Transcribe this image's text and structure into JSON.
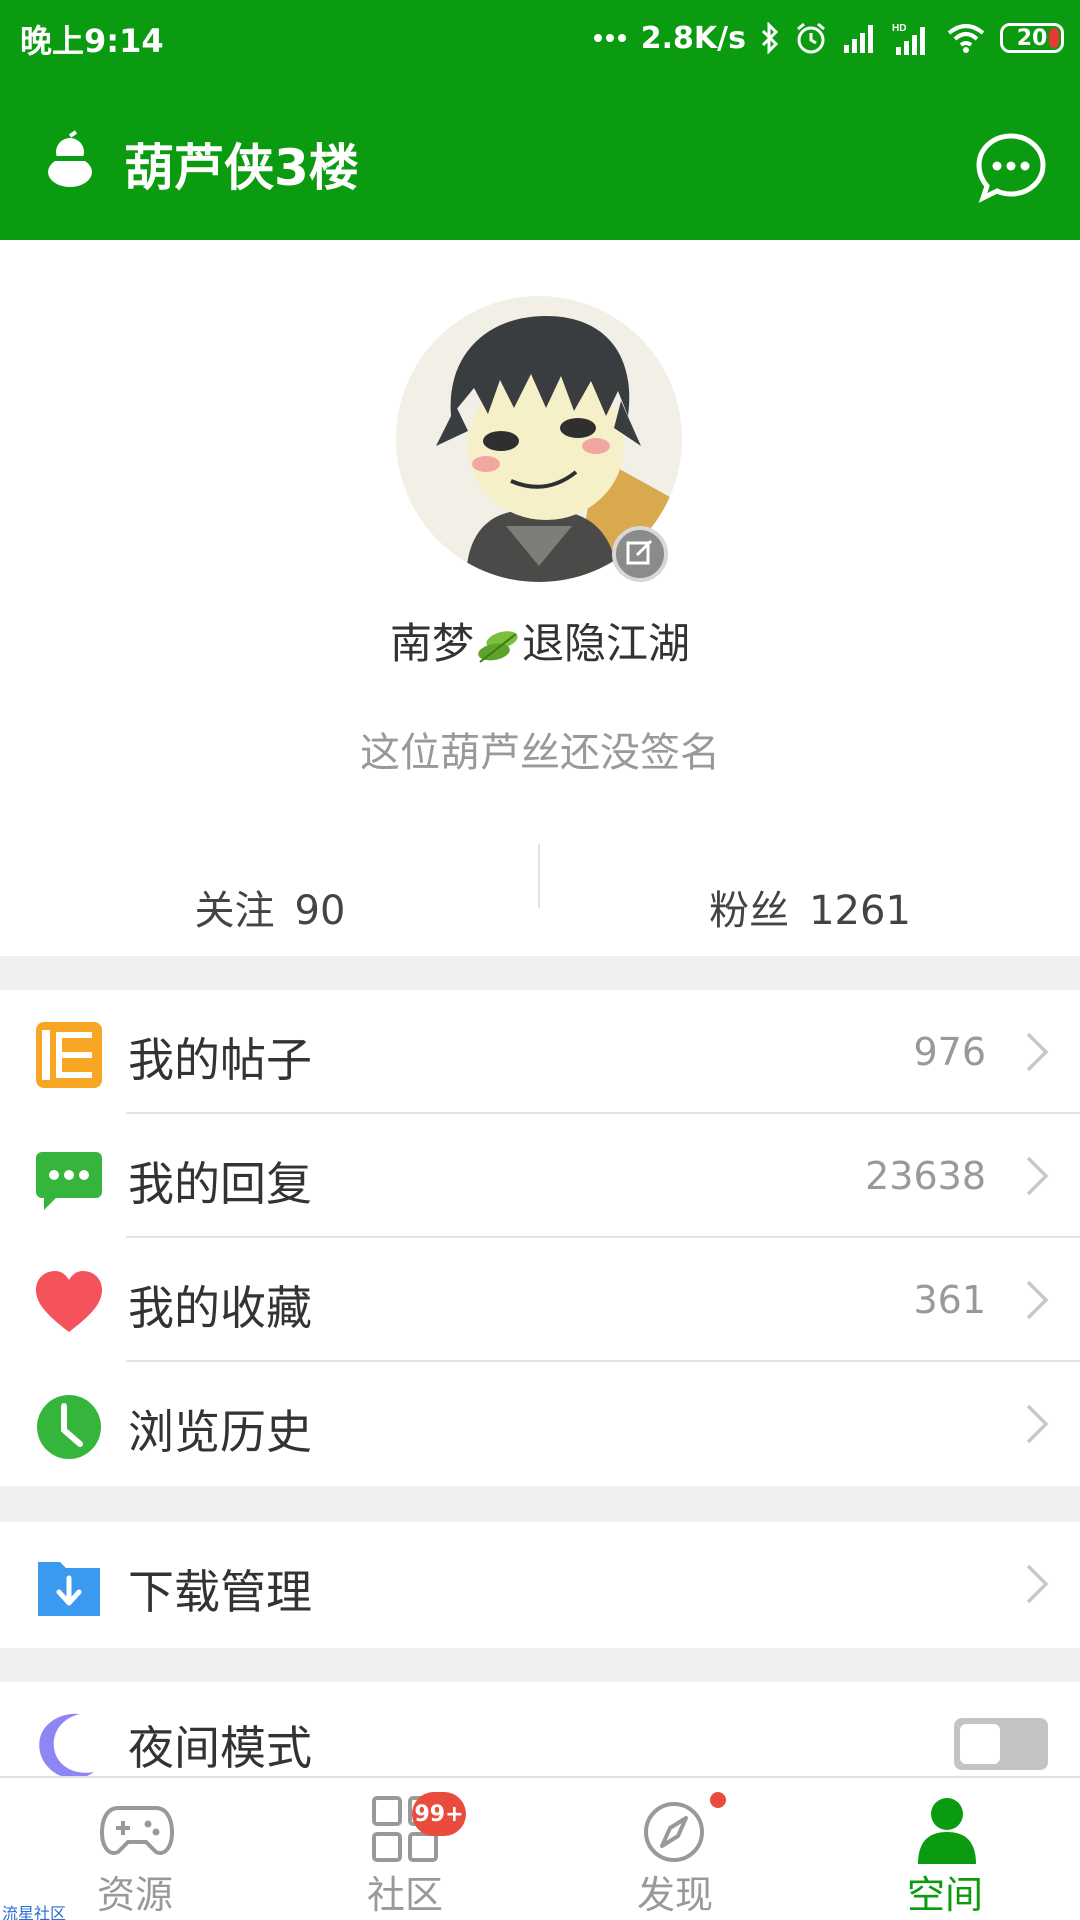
{
  "status_bar": {
    "time": "晚上9:14",
    "network_speed": "2.8K/s",
    "battery": "20",
    "icons": [
      "dots-icon",
      "bluetooth-icon",
      "alarm-icon",
      "signal-icon",
      "hd-signal-icon",
      "wifi-icon",
      "battery-icon"
    ]
  },
  "header": {
    "title": "葫芦侠3楼",
    "logo_icon": "gourd-logo-icon",
    "message_icon": "chat-bubble-icon"
  },
  "profile": {
    "username_part1": "南梦",
    "username_part2": "退隐江湖",
    "signature": "这位葫芦丝还没签名",
    "follow_label": "关注",
    "follow_count": "90",
    "fans_label": "粉丝",
    "fans_count": "1261"
  },
  "menu": {
    "posts": {
      "label": "我的帖子",
      "count": "976",
      "icon": "posts-icon"
    },
    "replies": {
      "label": "我的回复",
      "count": "23638",
      "icon": "reply-icon"
    },
    "favorites": {
      "label": "我的收藏",
      "count": "361",
      "icon": "heart-icon"
    },
    "history": {
      "label": "浏览历史",
      "icon": "clock-icon"
    },
    "downloads": {
      "label": "下载管理",
      "icon": "download-icon"
    },
    "night_mode": {
      "label": "夜间模式",
      "icon": "moon-icon",
      "enabled": false
    }
  },
  "bottom_nav": {
    "resources": "资源",
    "community": "社区",
    "community_badge": "99+",
    "discover": "发现",
    "space": "空间"
  },
  "colors": {
    "brand_green": "#0b9b10",
    "badge_red": "#e94b3c",
    "posts_orange": "#f6a623",
    "reply_green": "#36b53d",
    "heart_red": "#f4535b",
    "download_blue": "#3a9af0",
    "moon_purple": "#8f86f5"
  },
  "watermark": "流星社区"
}
